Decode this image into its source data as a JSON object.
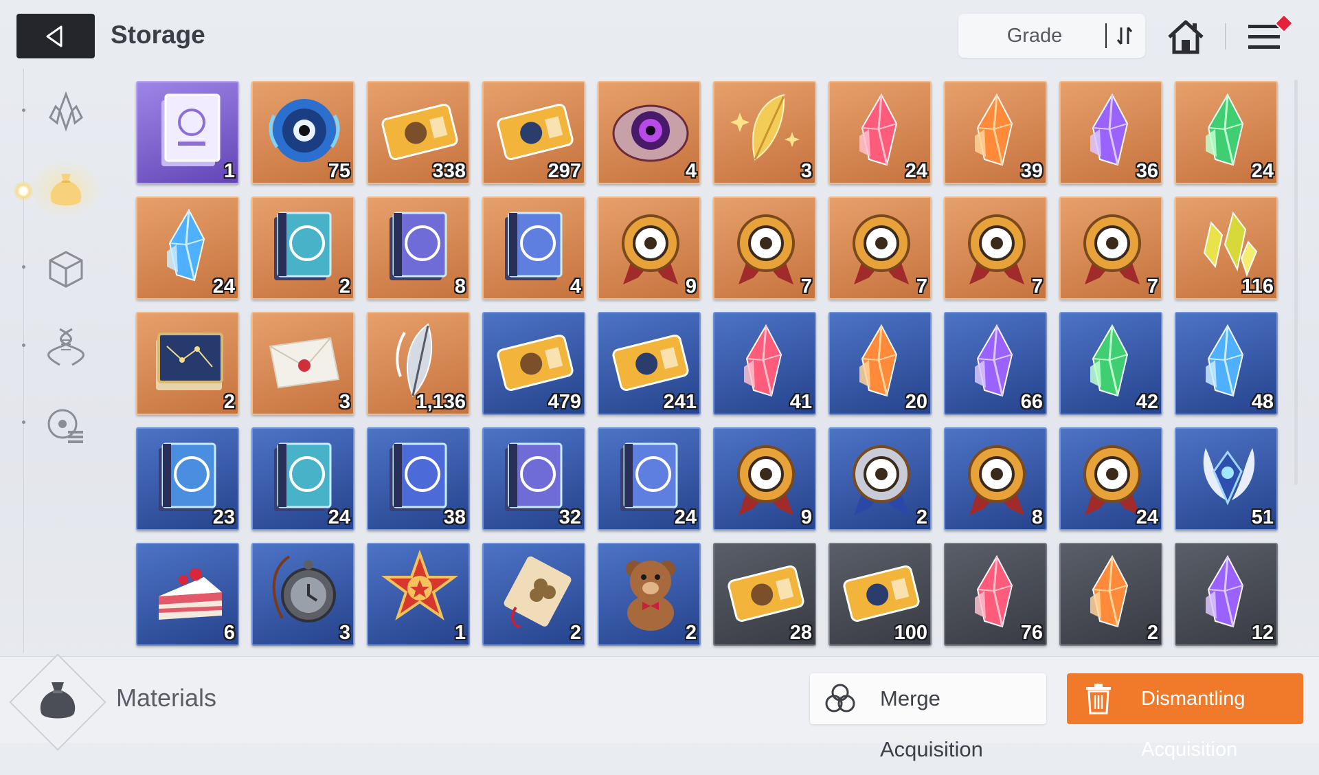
{
  "header": {
    "title": "Storage",
    "sort_label": "Grade"
  },
  "sidebar": {
    "tabs": [
      {
        "icon": "crystal-tab-icon",
        "active": false
      },
      {
        "icon": "material-bag-tab-icon",
        "active": true
      },
      {
        "icon": "cube-tab-icon",
        "active": false
      },
      {
        "icon": "dna-tab-icon",
        "active": false
      },
      {
        "icon": "module-list-tab-icon",
        "active": false
      }
    ]
  },
  "items": [
    {
      "icon": "manual-book-icon",
      "tier": "purple",
      "count": "1"
    },
    {
      "icon": "eye-core-icon",
      "tier": "orange",
      "count": "75"
    },
    {
      "icon": "recruit-ticket-icon",
      "tier": "orange",
      "count": "338"
    },
    {
      "icon": "star-ticket-icon",
      "tier": "orange",
      "count": "297"
    },
    {
      "icon": "purple-eye-core-icon",
      "tier": "orange",
      "count": "4"
    },
    {
      "icon": "golden-feather-icon",
      "tier": "orange",
      "count": "3"
    },
    {
      "icon": "red-crystal-icon",
      "tier": "orange",
      "count": "24"
    },
    {
      "icon": "orange-crystal-icon",
      "tier": "orange",
      "count": "39"
    },
    {
      "icon": "purple-crystal-icon",
      "tier": "orange",
      "count": "36"
    },
    {
      "icon": "green-crystal-icon",
      "tier": "orange",
      "count": "24"
    },
    {
      "icon": "blue-crystal-icon",
      "tier": "orange",
      "count": "24"
    },
    {
      "icon": "shield-book-icon",
      "tier": "orange",
      "count": "2"
    },
    {
      "icon": "lightning-book-icon",
      "tier": "orange",
      "count": "8"
    },
    {
      "icon": "atom-book-icon",
      "tier": "orange",
      "count": "4"
    },
    {
      "icon": "sword-medal-icon",
      "tier": "orange",
      "count": "9"
    },
    {
      "icon": "shield-medal-icon",
      "tier": "orange",
      "count": "7"
    },
    {
      "icon": "cross-medal-icon",
      "tier": "orange",
      "count": "7"
    },
    {
      "icon": "lightning-medal-icon",
      "tier": "orange",
      "count": "7"
    },
    {
      "icon": "atom-medal-icon",
      "tier": "orange",
      "count": "7"
    },
    {
      "icon": "crystal-shards-icon",
      "tier": "orange",
      "count": "116"
    },
    {
      "icon": "star-map-book-icon",
      "tier": "orange",
      "count": "2"
    },
    {
      "icon": "sealed-letter-icon",
      "tier": "orange",
      "count": "3"
    },
    {
      "icon": "silver-feather-icon",
      "tier": "orange",
      "count": "1,136"
    },
    {
      "icon": "recruit-ticket-icon",
      "tier": "blue",
      "count": "479"
    },
    {
      "icon": "star-ticket-icon",
      "tier": "blue",
      "count": "241"
    },
    {
      "icon": "red-crystal-icon",
      "tier": "blue",
      "count": "41"
    },
    {
      "icon": "orange-crystal-icon",
      "tier": "blue",
      "count": "20"
    },
    {
      "icon": "purple-crystal-icon",
      "tier": "blue",
      "count": "66"
    },
    {
      "icon": "green-crystal-icon",
      "tier": "blue",
      "count": "42"
    },
    {
      "icon": "blue-crystal-icon",
      "tier": "blue",
      "count": "48"
    },
    {
      "icon": "sword-book-icon",
      "tier": "blue",
      "count": "23"
    },
    {
      "icon": "shield-book-icon",
      "tier": "blue",
      "count": "24"
    },
    {
      "icon": "target-book-icon",
      "tier": "blue",
      "count": "38"
    },
    {
      "icon": "lightning-book-icon",
      "tier": "blue",
      "count": "32"
    },
    {
      "icon": "atom-book-icon",
      "tier": "blue",
      "count": "24"
    },
    {
      "icon": "sword-medal-icon",
      "tier": "blue",
      "count": "9"
    },
    {
      "icon": "target-medal-icon",
      "tier": "blue",
      "count": "2"
    },
    {
      "icon": "cross-medal-icon",
      "tier": "blue",
      "count": "8"
    },
    {
      "icon": "lightning-medal-icon",
      "tier": "blue",
      "count": "24"
    },
    {
      "icon": "winged-crystal-icon",
      "tier": "blue",
      "count": "51"
    },
    {
      "icon": "cake-icon",
      "tier": "blue",
      "count": "6"
    },
    {
      "icon": "pocket-watch-icon",
      "tier": "blue",
      "count": "3"
    },
    {
      "icon": "star-badge-icon",
      "tier": "blue",
      "count": "1"
    },
    {
      "icon": "clover-tag-icon",
      "tier": "blue",
      "count": "2"
    },
    {
      "icon": "teddy-bear-icon",
      "tier": "blue",
      "count": "2"
    },
    {
      "icon": "recruit-ticket-icon",
      "tier": "gray",
      "count": "28"
    },
    {
      "icon": "star-ticket-icon",
      "tier": "gray",
      "count": "100"
    },
    {
      "icon": "red-crystal-icon",
      "tier": "gray",
      "count": "76"
    },
    {
      "icon": "orange-crystal-icon",
      "tier": "gray",
      "count": "2"
    },
    {
      "icon": "purple-crystal-icon",
      "tier": "gray",
      "count": "12"
    }
  ],
  "footer": {
    "category_label": "Materials",
    "merge_label": "Merge Acquisition",
    "dismantle_label": "Dismantling Acquisition"
  }
}
